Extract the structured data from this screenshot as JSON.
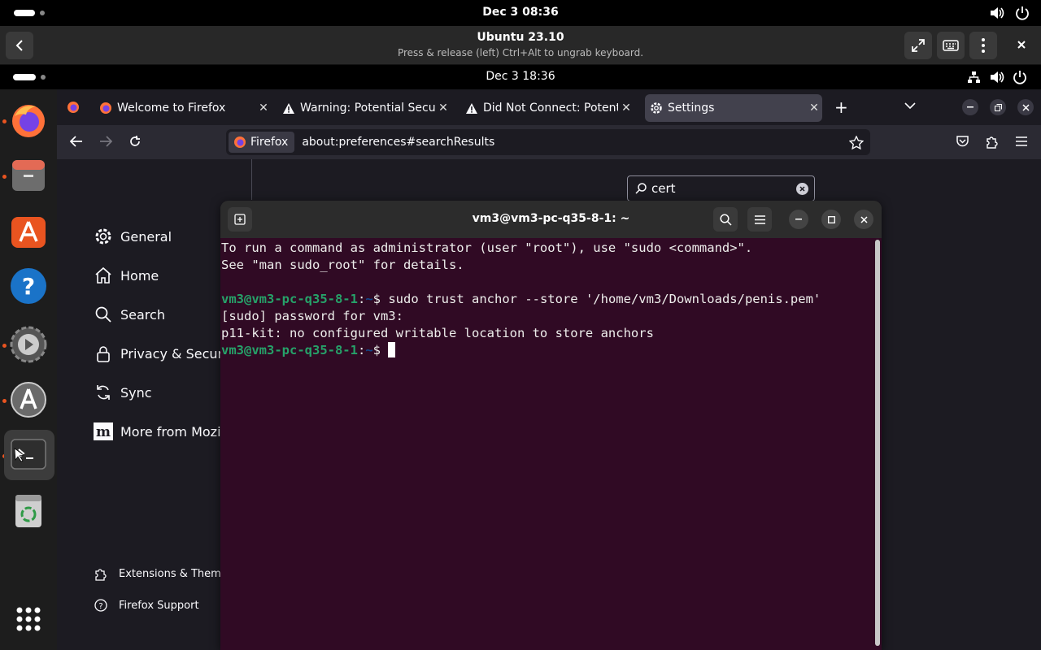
{
  "host": {
    "clock": "Dec 3  08:36"
  },
  "remote": {
    "title": "Ubuntu 23.10",
    "subtitle": "Press & release (left) Ctrl+Alt to ungrab keyboard."
  },
  "guest": {
    "clock": "Dec 3  18:36"
  },
  "dock": {
    "items": [
      "firefox",
      "files",
      "app-center",
      "help",
      "settings",
      "software-updater",
      "terminal",
      "trash",
      "show-apps"
    ]
  },
  "firefox": {
    "tabs": [
      {
        "label": "Welcome to Firefox"
      },
      {
        "label": "Warning: Potential Securi"
      },
      {
        "label": "Did Not Connect: Potenti"
      },
      {
        "label": "Settings"
      }
    ],
    "url_identity": "Firefox",
    "url": "about:preferences#searchResults",
    "search_value": "cert",
    "sidebar": [
      {
        "label": "General"
      },
      {
        "label": "Home"
      },
      {
        "label": "Search"
      },
      {
        "label": "Privacy & Security"
      },
      {
        "label": "Sync"
      },
      {
        "label": "More from Mozilla"
      }
    ],
    "footer": [
      {
        "label": "Extensions & Themes"
      },
      {
        "label": "Firefox Support"
      }
    ]
  },
  "terminal": {
    "title": "vm3@vm3-pc-q35-8-1: ~",
    "line1": "To run a command as administrator (user \"root\"), use \"sudo <command>\".",
    "line2": "See \"man sudo_root\" for details.",
    "prompt_user": "vm3@vm3-pc-q35-8-1",
    "prompt_sep": ":",
    "prompt_path": "~",
    "prompt_dollar": "$ ",
    "command": "sudo trust anchor --store '/home/vm3/Downloads/penis.pem'",
    "line4": "[sudo] password for vm3:",
    "line5": "p11-kit: no configured writable location to store anchors"
  },
  "colors": {
    "terminal_bg": "#300a24",
    "prompt_user": "#26a269",
    "prompt_path": "#12488b",
    "accent": "#e95420"
  }
}
